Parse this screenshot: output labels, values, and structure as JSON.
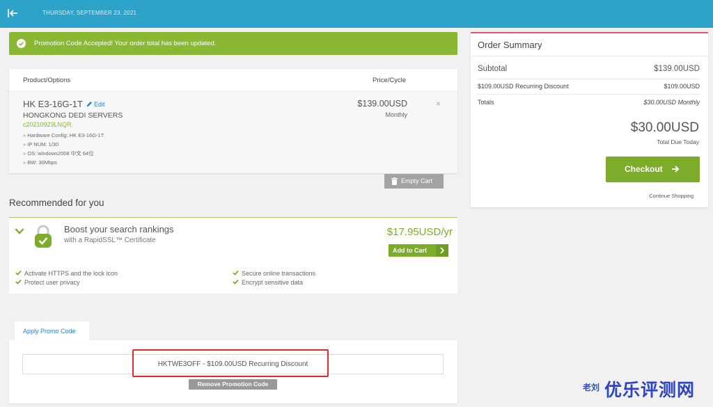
{
  "header": {
    "back_icon": "collapse-left-icon",
    "date": "THURSDAY, SEPTEMBER 23, 2021"
  },
  "alert": {
    "icon": "check-circle-icon",
    "message": "Promotion Code Accepted! Your order total has been updated.",
    "color": "#8ab833"
  },
  "cart": {
    "headers": {
      "product": "Product/Options",
      "price": "Price/Cycle"
    },
    "item": {
      "name": "HK E3-16G-1T",
      "edit_label": "Edit",
      "group": "HONGKONG DEDI SERVERS",
      "domain": "c20210923LNQR.",
      "options": [
        "Hardware Config: HK E3-16G-1T",
        "IP NUM: 1/30",
        "OS: windows2008 中文 64位",
        "BW: 30Mbps"
      ],
      "price": "$139.00USD",
      "cycle": "Monthly",
      "remove": "×"
    },
    "empty_cart_label": "Empty Cart"
  },
  "recommended": {
    "title": "Recommended for you",
    "product": {
      "headline": "Boost your search rankings",
      "subtitle": "with a RapidSSL™ Certificate",
      "price": "$17.95USD/yr",
      "add_label": "Add to Cart",
      "features": [
        "Activate HTTPS and the lock icon",
        "Protect user privacy",
        "Secure online transactions",
        "Encrypt sensitive data"
      ]
    }
  },
  "summary": {
    "title": "Order Summary",
    "subtotal_label": "Subtotal",
    "subtotal_value": "$139.00USD",
    "discount_label": "$109.00USD Recurring Discount",
    "discount_value": "$109.00USD",
    "totals_label": "Totals",
    "totals_value": "$30.00USD Monthly",
    "total_due": "$30.00USD",
    "total_due_label": "Total Due Today",
    "checkout_label": "Checkout",
    "continue_label": "Continue Shopping",
    "accent_color": "#e2557a"
  },
  "promo": {
    "tab_label": "Apply Promo Code",
    "applied_code": "HKTWE3OFF - $109.00USD Recurring Discount",
    "remove_label": "Remove Promotion Code"
  },
  "watermark": {
    "small": "老刘",
    "large": "优乐评测网"
  },
  "colors": {
    "topbar": "#2da3c9",
    "green": "#7cac2a",
    "link": "#2a82c7",
    "highlight_red": "#e0262a"
  }
}
